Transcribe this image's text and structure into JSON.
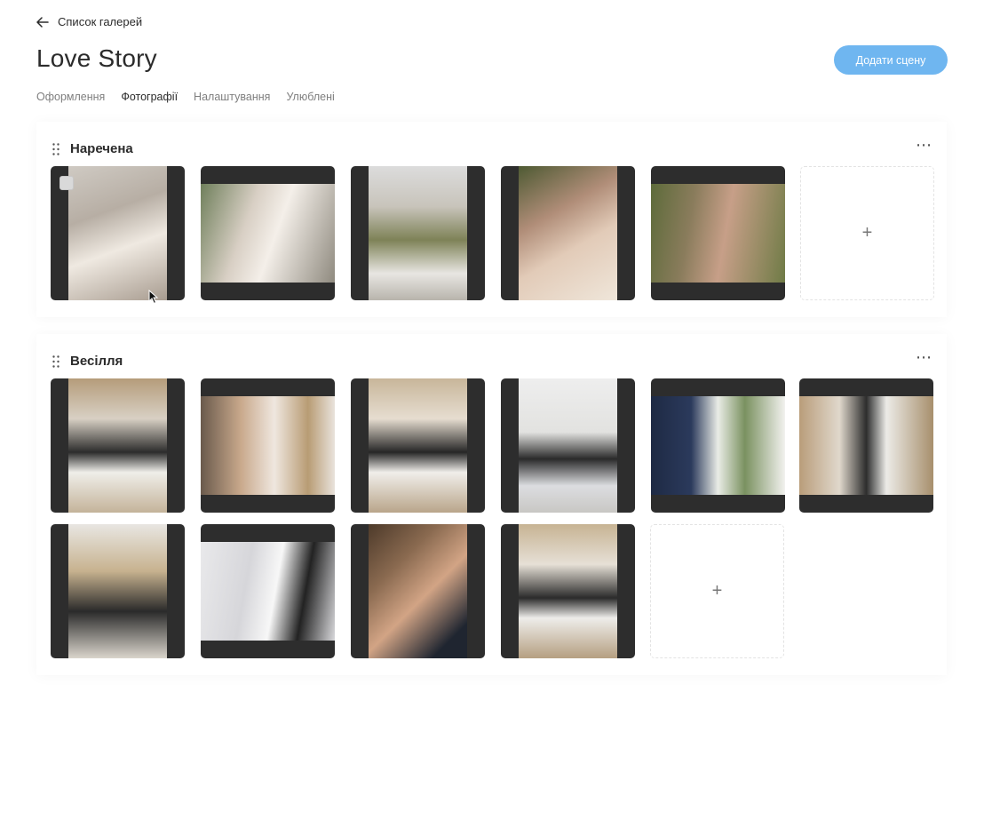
{
  "nav": {
    "back_label": "Список галерей"
  },
  "page": {
    "title": "Love Story"
  },
  "actions": {
    "add_scene_label": "Додати сцену"
  },
  "colors": {
    "accent": "#6fb6f0",
    "photo_frame": "#2d2d2d"
  },
  "tabs": [
    {
      "label": "Оформлення",
      "active": false
    },
    {
      "label": "Фотографії",
      "active": true
    },
    {
      "label": "Налаштування",
      "active": false
    },
    {
      "label": "Улюблені",
      "active": false
    }
  ],
  "sections": [
    {
      "title": "Наречена",
      "photo_count": 5,
      "add_tile_label": "+"
    },
    {
      "title": "Весілля",
      "photo_count": 10,
      "add_tile_label": "+"
    }
  ],
  "icons": {
    "back": "arrow-left-icon",
    "drag": "drag-handle-icon",
    "more": "more-horizontal-icon",
    "more_glyph": "⋯"
  }
}
